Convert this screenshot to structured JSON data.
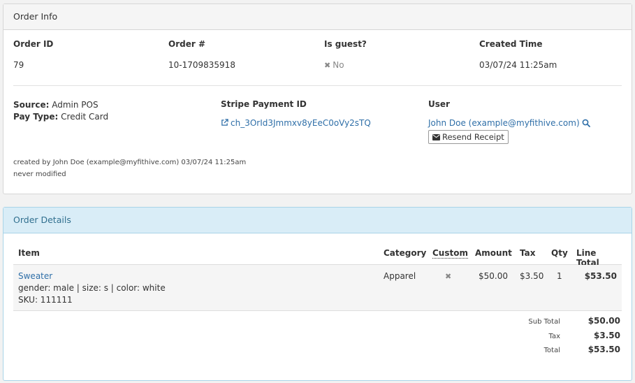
{
  "order_info": {
    "heading": "Order Info",
    "order_id_label": "Order ID",
    "order_id": "79",
    "order_num_label": "Order #",
    "order_num": "10-1709835918",
    "is_guest_label": "Is guest?",
    "is_guest": "No",
    "created_label": "Created Time",
    "created": "03/07/24 11:25am",
    "source_label": "Source:",
    "source": "Admin POS",
    "pay_type_label": "Pay Type:",
    "pay_type": "Credit Card",
    "stripe_label": "Stripe Payment ID",
    "stripe_id": "ch_3OrId3Jmmxv8yEeC0oVy2sTQ",
    "user_label": "User",
    "user": "John Doe (example@myfithive.com)",
    "resend_label": "Resend Receipt",
    "created_by": "created by John Doe (example@myfithive.com) 03/07/24 11:25am",
    "modified": "never modified"
  },
  "order_details": {
    "heading": "Order Details",
    "columns": {
      "item": "Item",
      "category": "Category",
      "custom": "Custom",
      "amount": "Amount",
      "tax": "Tax",
      "qty": "Qty",
      "line_total": "Line Total"
    },
    "rows": [
      {
        "item_name": "Sweater",
        "item_options": "gender: male | size: s | color: white",
        "sku": "SKU: 111111",
        "category": "Apparel",
        "custom": "✖",
        "amount": "$50.00",
        "tax": "$3.50",
        "qty": "1",
        "line_total": "$53.50"
      }
    ],
    "totals": {
      "sub_total_label": "Sub Total",
      "sub_total": "$50.00",
      "tax_label": "Tax",
      "tax": "$3.50",
      "total_label": "Total",
      "total": "$53.50"
    }
  },
  "icons": {
    "guest_no": "times-icon",
    "stripe_link": "external-link-icon",
    "user_search": "search-icon",
    "resend": "envelope-icon"
  },
  "colors": {
    "link": "#2f6fa8",
    "details_heading_bg": "#d9edf7",
    "details_heading_text": "#31708f"
  }
}
